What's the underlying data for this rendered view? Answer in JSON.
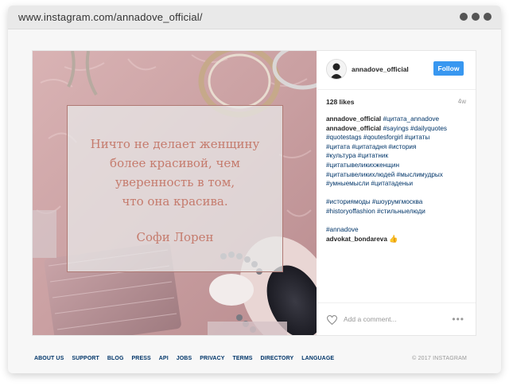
{
  "browser": {
    "url": "www.instagram.com/annadove_official/"
  },
  "post": {
    "image": {
      "quote_lines": [
        "Ничто не делает женщину",
        "более красивой, чем",
        "уверенность в том,",
        "что она красива."
      ],
      "quote_author": "Софи Лорен"
    },
    "header": {
      "username": "annadove_official",
      "follow_label": "Follow"
    },
    "likes": "128 likes",
    "age": "4w",
    "comments": {
      "c1_user": "annadove_official",
      "c1_tag": "#цитата_annadove",
      "c2_user": "annadove_official",
      "c2_lines": [
        "#sayings #dailyquotes",
        "#quotestags #qoutesforgirl #цитаты",
        "#цитата #цитатадня #история",
        "#культура #цитатник",
        "#цитатывеликихженщин",
        "#цитатывеликихлюдей #мыслимудрых",
        "#умныемысли #цитатаденьи"
      ],
      "c3_lines": [
        "#историямоды #шоурумгмосква",
        "#historyoffashion #стильныелюди"
      ],
      "c4_line": "#annadove",
      "c5_user": "advokat_bondareva",
      "c5_emoji": "👍"
    },
    "add_comment_placeholder": "Add a comment...",
    "more_label": "•••"
  },
  "footer": {
    "links": [
      "ABOUT US",
      "SUPPORT",
      "BLOG",
      "PRESS",
      "API",
      "JOBS",
      "PRIVACY",
      "TERMS",
      "DIRECTORY",
      "LANGUAGE"
    ],
    "copyright": "© 2017 INSTAGRAM"
  },
  "colors": {
    "follow_button": "#3897f0",
    "hashtag": "#003569",
    "quote_text": "#c57b6d"
  },
  "icons": [
    "more-dots-icon",
    "heart-icon",
    "avatar"
  ]
}
